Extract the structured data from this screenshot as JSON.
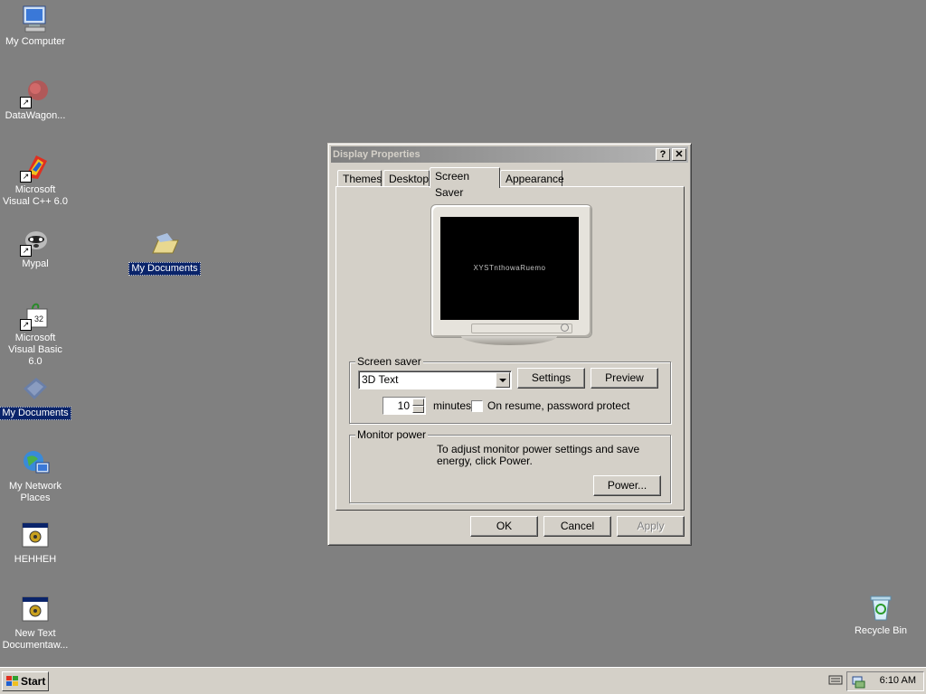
{
  "desktop": {
    "icons": [
      {
        "label": "My Computer",
        "icon": "computer-icon"
      },
      {
        "label": "DataWagon...",
        "icon": "datawagon-icon"
      },
      {
        "label": "Microsoft Visual C++ 6.0",
        "icon": "visual-cpp-icon"
      },
      {
        "label": "Mypal",
        "icon": "mypal-icon"
      },
      {
        "label": "Microsoft Visual Basic 6.0",
        "icon": "visual-basic-icon"
      },
      {
        "label": "My Documents",
        "icon": "documents-icon"
      },
      {
        "label": "My Network Places",
        "icon": "network-icon"
      },
      {
        "label": "HEHHEH",
        "icon": "text-document-icon"
      },
      {
        "label": "New Text Documentaw...",
        "icon": "text-document-icon"
      },
      {
        "label": "My Documents",
        "icon": "folder-icon"
      },
      {
        "label": "Recycle Bin",
        "icon": "recycle-bin-icon"
      }
    ]
  },
  "dialog": {
    "title": "Display Properties",
    "help_button": "?",
    "close_button": "✕",
    "tabs": [
      "Themes",
      "Desktop",
      "Screen Saver",
      "Appearance"
    ],
    "active_tab": "Screen Saver",
    "preview_text": "XYSTnthowaRuemo",
    "screensaver_group": "Screen saver",
    "screensaver_value": "3D Text",
    "settings_button": "Settings",
    "preview_button": "Preview",
    "wait_value": "10",
    "minutes_label": "minutes",
    "password_label": "On resume, password protect",
    "power_group": "Monitor power",
    "power_text": "To adjust monitor power settings and save energy, click Power.",
    "power_button": "Power...",
    "ok_button": "OK",
    "cancel_button": "Cancel",
    "apply_button": "Apply"
  },
  "taskbar": {
    "start_label": "Start",
    "clock": "6:10 AM"
  }
}
